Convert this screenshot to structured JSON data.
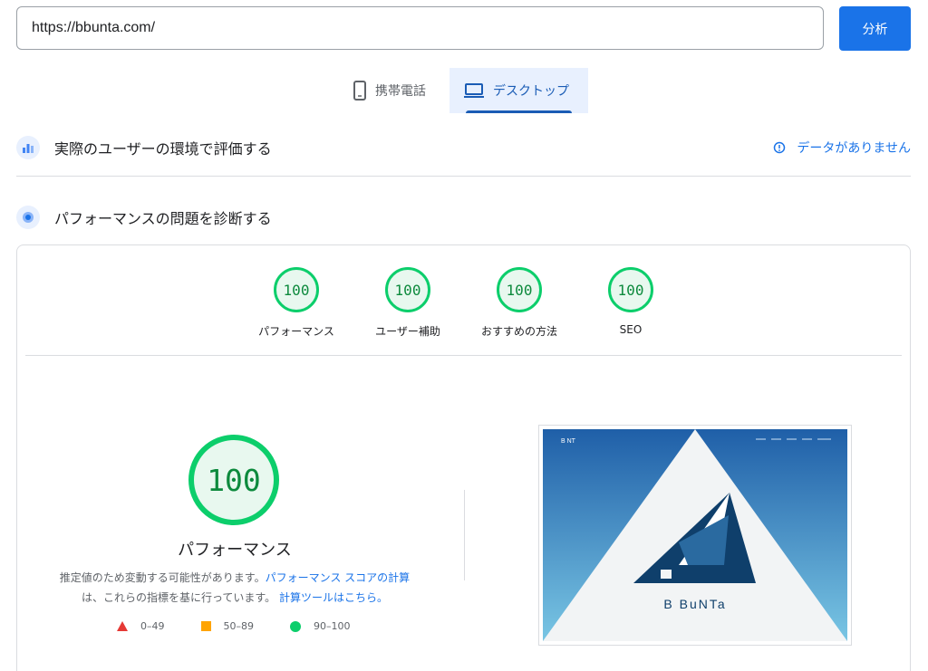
{
  "url_input": {
    "value": "https://bbunta.com/"
  },
  "analyze_button": {
    "label": "分析"
  },
  "device_tabs": [
    {
      "label": "携帯電話",
      "icon": "phone-icon",
      "selected": false
    },
    {
      "label": "デスクトップ",
      "icon": "laptop-icon",
      "selected": true
    }
  ],
  "field_data": {
    "title": "実際のユーザーの環境で評価する",
    "no_data_label": "データがありません",
    "info_icon": "info-icon"
  },
  "lab_data": {
    "title": "パフォーマンスの問題を診断する"
  },
  "categories": [
    {
      "label": "パフォーマンス",
      "score": "100"
    },
    {
      "label": "ユーザー補助",
      "score": "100"
    },
    {
      "label": "おすすめの方法",
      "score": "100"
    },
    {
      "label": "SEO",
      "score": "100"
    }
  ],
  "performance": {
    "score": "100",
    "label": "パフォーマンス",
    "note_text_1": "推定値のため変動する可能性があります。",
    "note_link_1": "パフォーマンス スコアの計算",
    "note_text_2": "は、これらの指標を基に行っています。",
    "note_link_2": "計算ツールはこちら。"
  },
  "legend": [
    {
      "range": "0–49",
      "symbol": "red-triangle",
      "color": "#e53935"
    },
    {
      "range": "50–89",
      "symbol": "orange-square",
      "color": "#ffa400"
    },
    {
      "range": "90–100",
      "symbol": "green-circle",
      "color": "#0cce6b"
    }
  ],
  "screenshot": {
    "brand_text": "B BuNTa",
    "header_logo_text": "B NT"
  },
  "colors": {
    "accent": "#1a73e8",
    "pass": "#0cce6b",
    "pass_text": "#0d8a3d"
  }
}
